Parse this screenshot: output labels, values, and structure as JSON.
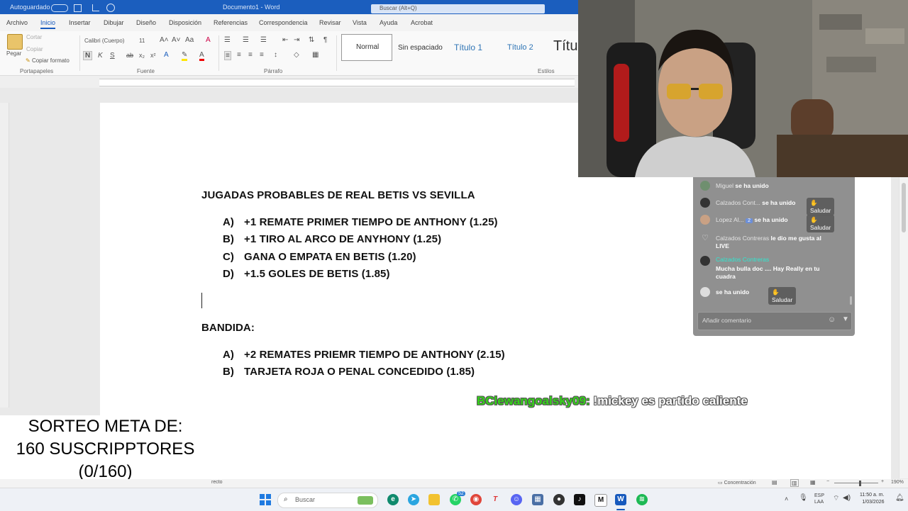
{
  "titlebar": {
    "autosave": "Autoguardado",
    "doc_title": "Documento1 - Word",
    "search_placeholder": "Buscar (Alt+Q)"
  },
  "tabs": [
    "Archivo",
    "Inicio",
    "Insertar",
    "Dibujar",
    "Diseño",
    "Disposición",
    "Referencias",
    "Correspondencia",
    "Revisar",
    "Vista",
    "Ayuda",
    "Acrobat"
  ],
  "ribbon": {
    "paste": "Pegar",
    "cut": "Cortar",
    "copy": "Copiar",
    "format_painter": "Copiar formato",
    "font_name": "Calibri (Cuerpo)",
    "font_size": "11",
    "groups": {
      "clipboard": "Portapapeles",
      "font": "Fuente",
      "paragraph": "Párrafo",
      "styles": "Estilos"
    },
    "styles": [
      "Normal",
      "Sin espaciado",
      "Título 1",
      "Título 2",
      "Títu"
    ]
  },
  "document": {
    "heading": "JUGADAS PROBABLES DE REAL BETIS VS SEVILLA",
    "list1": [
      {
        "letter": "A)",
        "text": "+1 REMATE PRIMER TIEMPO DE ANTHONY (1.25)"
      },
      {
        "letter": "B)",
        "text": "+1 TIRO AL ARCO DE ANYHONY (1.25)"
      },
      {
        "letter": "C)",
        "text": "GANA O EMPATA EN BETIS (1.20)"
      },
      {
        "letter": "D)",
        "text": "+1.5 GOLES DE BETIS (1.85)"
      }
    ],
    "heading2": "BANDIDA:",
    "list2": [
      {
        "letter": "A)",
        "text": "+2 REMATES PRIEMR TIEMPO DE ANTHONY (2.15)"
      },
      {
        "letter": "B)",
        "text": "TARJETA ROJA O PENAL CONCEDIDO (1.85)"
      }
    ]
  },
  "chat": {
    "rows": [
      {
        "user": "Miguel",
        "action": "se ha unido"
      },
      {
        "user": "Calzados Cont...",
        "action": "se ha unido",
        "button": "Saludar"
      },
      {
        "user": "Lopez Al...",
        "badge": "2",
        "action": "se ha unido",
        "button": "Saludar"
      },
      {
        "user": "Calzados Contreras",
        "action": "le dio me gusta al LIVE"
      },
      {
        "user": "Calzados Contreras",
        "message": "Mucha bulla doc .... Hay Really en tu cuadra"
      },
      {
        "user": "",
        "action": "se ha unido",
        "button": "Saludar"
      }
    ],
    "input_placeholder": "Añadir comentario"
  },
  "overlay": {
    "user": "BClewangoalsky09:",
    "message": " !mickey es partido caliente"
  },
  "sorteo": {
    "line1": "SORTEO META DE:",
    "line2": "160 SUSCRIPPTORES",
    "line3": "(0/160)"
  },
  "status": {
    "left": "recto",
    "focus": "Concentración",
    "zoom": "190%"
  },
  "taskbar": {
    "search": "Buscar",
    "lang1": "ESP",
    "lang2": "LAA",
    "time": "11:50 a. m.",
    "date": "1/03/2026",
    "whatsapp_badge": "52"
  }
}
